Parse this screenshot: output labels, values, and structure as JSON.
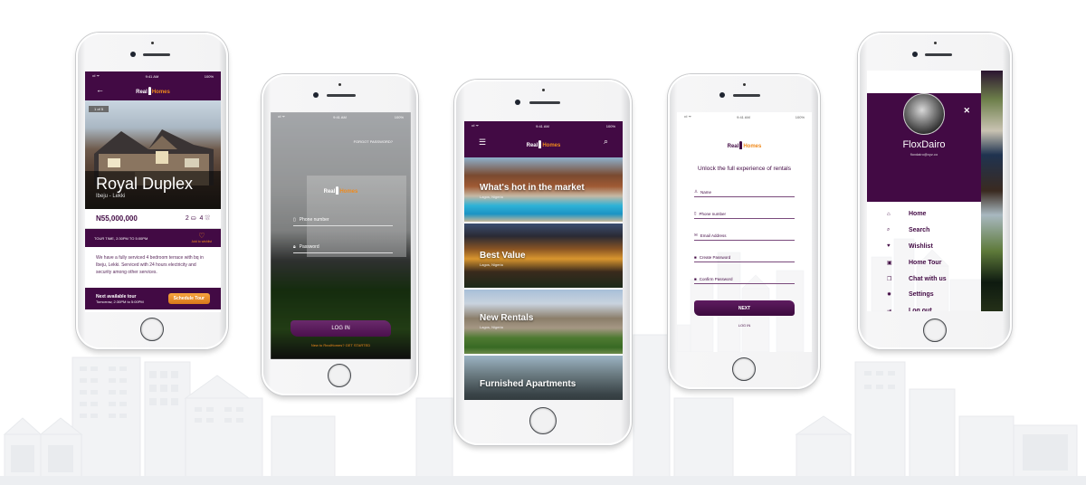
{
  "status_bar": {
    "time": "9:41 AM",
    "battery": "100%",
    "signal": "•ıl ᯤ"
  },
  "brand": {
    "real": "Real",
    "homes": "Homes",
    "primary_color": "#420a44",
    "accent_color": "#f08a1c"
  },
  "property_detail": {
    "back_icon": "←",
    "photo_counter": "1 of 5",
    "title": "Royal Duplex",
    "location": "Ibeju - Lekki",
    "price": "N55,000,000",
    "bathrooms": "2",
    "bedrooms": "4",
    "tour_time": "TOUR TIME, 2:30PM TO 5:00PM",
    "wishlist_label": "Add to wishlist",
    "description": "We have a fully serviced 4 bedroom terrace with bq in Ibeju, Lekki. Serviced with 24 hours electricity and security among other services.",
    "next_tour_title": "Next available tour",
    "next_tour_time": "Tomorrow, 2:30PM to 5:00PM",
    "schedule_button": "Schedule Tour"
  },
  "login": {
    "forgot_password": "FORGOT PASSWORD?",
    "phone_placeholder": "Phone number",
    "password_placeholder": "Password",
    "login_button": "LOG IN",
    "signup_prompt": "New to RealHomes? GET STARTED"
  },
  "home_feed": {
    "menu_icon": "☰",
    "search_icon": "⌕",
    "cards": [
      {
        "title": "What's hot in the market",
        "location": "Lagos, Nigeria"
      },
      {
        "title": "Best Value",
        "location": "Lagos, Nigeria"
      },
      {
        "title": "New Rentals",
        "location": "Lagos, Nigeria"
      },
      {
        "title": "Furnished Apartments",
        "location": ""
      }
    ]
  },
  "signup": {
    "heading": "Unlock the full experience of rentals",
    "fields": [
      {
        "icon": "person-icon",
        "placeholder": "Name"
      },
      {
        "icon": "phone-icon",
        "placeholder": "Phone number"
      },
      {
        "icon": "mail-icon",
        "placeholder": "Email Address"
      },
      {
        "icon": "lock-icon",
        "placeholder": "Create Password"
      },
      {
        "icon": "lock-icon",
        "placeholder": "Confirm Password"
      }
    ],
    "next_button": "NEXT",
    "login_link": "LOG IN"
  },
  "drawer": {
    "close_icon": "✕",
    "username": "FloxDairo",
    "email": "floxdairo@xyz.co",
    "items": [
      {
        "icon": "home-icon",
        "glyph": "⌂",
        "label": "Home"
      },
      {
        "icon": "search-icon",
        "glyph": "⌕",
        "label": "Search"
      },
      {
        "icon": "heart-icon",
        "glyph": "♥",
        "label": "Wishlist"
      },
      {
        "icon": "calendar-icon",
        "glyph": "▣",
        "label": "Home Tour"
      },
      {
        "icon": "chat-icon",
        "glyph": "❐",
        "label": "Chat with us"
      },
      {
        "icon": "gear-icon",
        "glyph": "✹",
        "label": "Settings"
      },
      {
        "icon": "logout-icon",
        "glyph": "⇥",
        "label": "Log out"
      }
    ]
  }
}
